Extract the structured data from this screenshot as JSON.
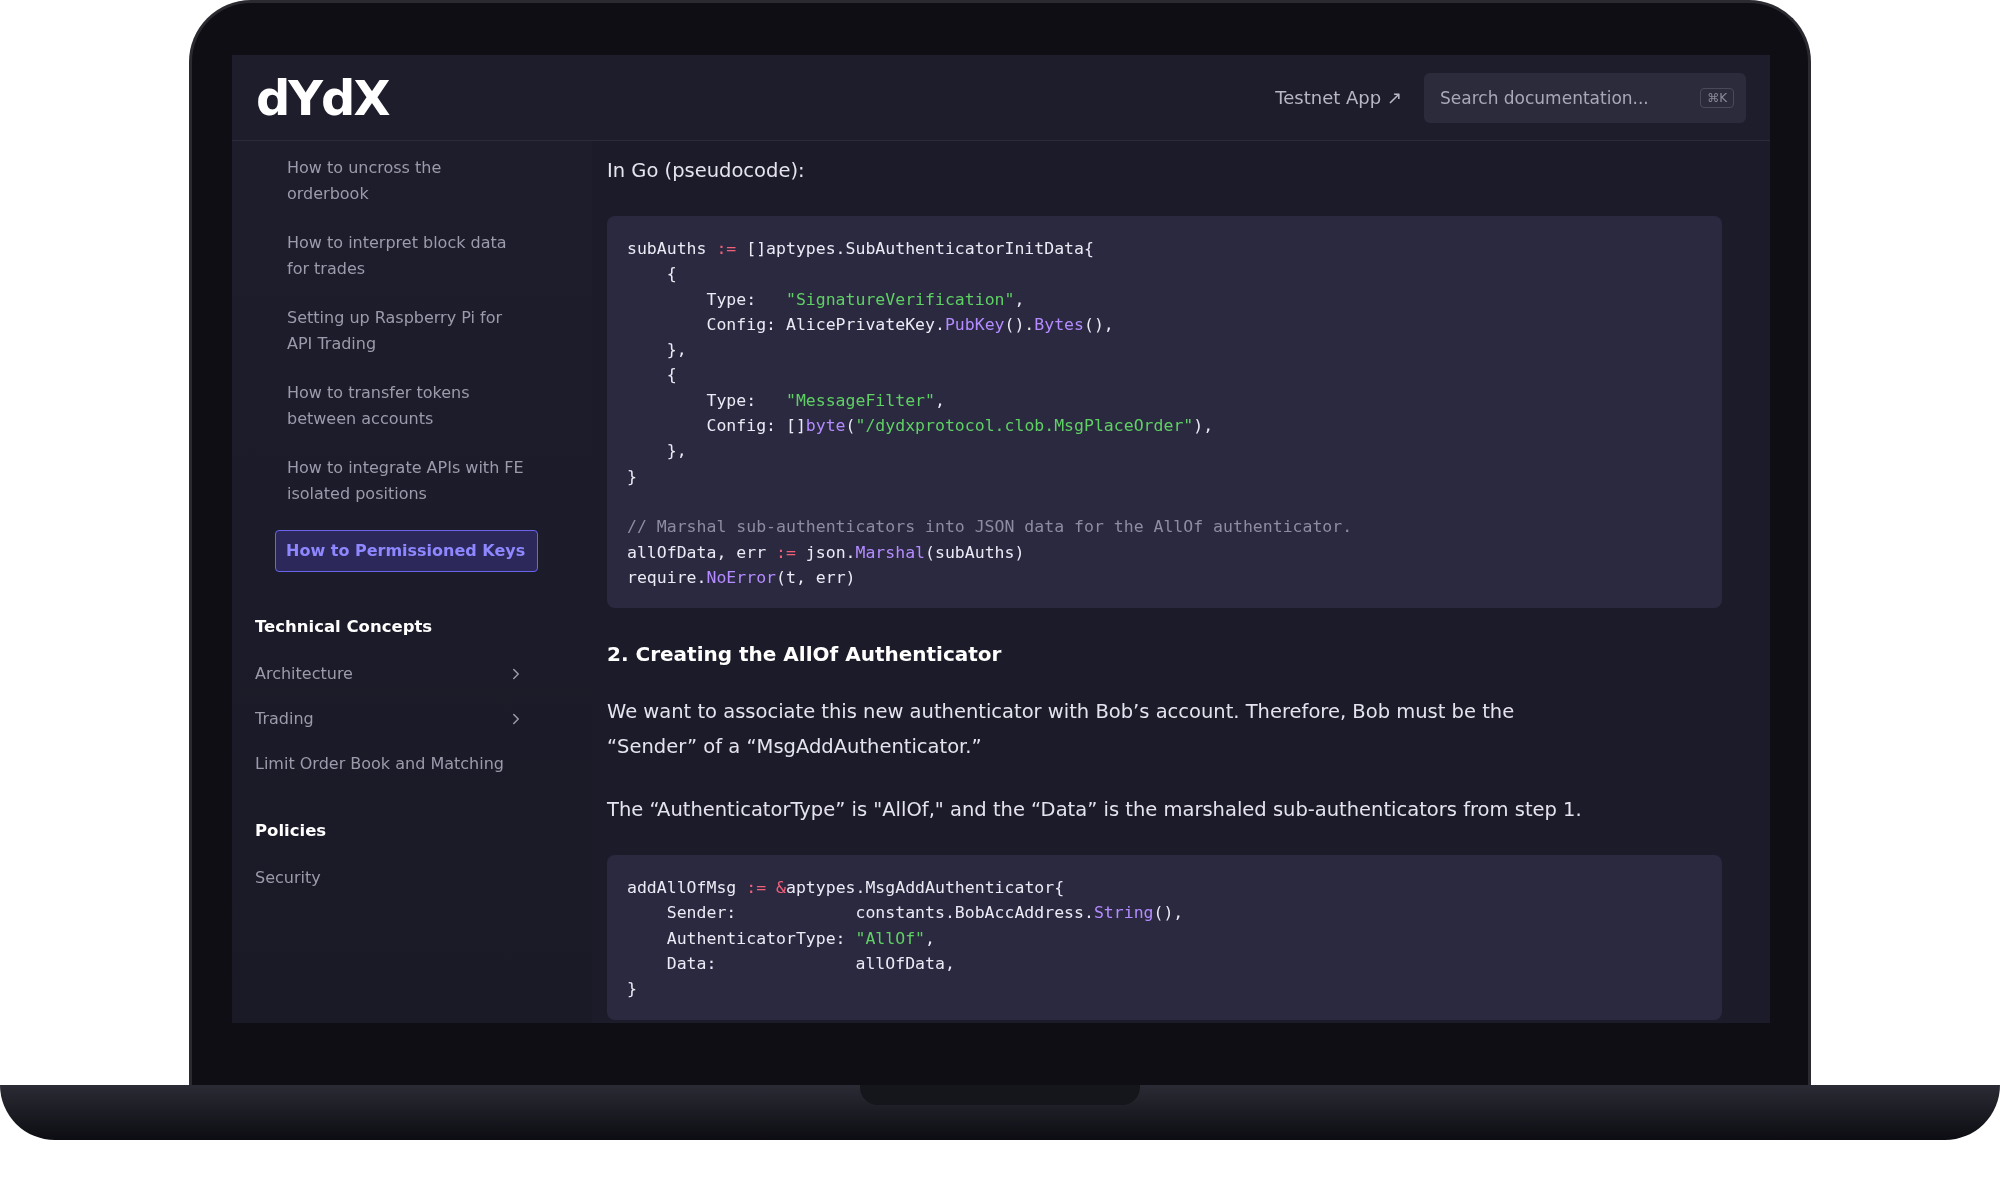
{
  "header": {
    "logo": "dYdX",
    "testnet_link": "Testnet App ↗",
    "search": {
      "placeholder": "Search documentation...",
      "shortcut": "⌘K"
    }
  },
  "sidebar": {
    "guides": [
      {
        "label": "How to uncross the orderbook",
        "selected": false
      },
      {
        "label": "How to interpret block data for trades",
        "selected": false
      },
      {
        "label": "Setting up Raspberry Pi for API Trading",
        "selected": false
      },
      {
        "label": "How to transfer tokens between accounts",
        "selected": false
      },
      {
        "label": "How to integrate APIs with FE isolated positions",
        "selected": false
      },
      {
        "label": "How to Permissioned Keys",
        "selected": true
      }
    ],
    "sections": [
      {
        "title": "Technical Concepts",
        "items": [
          {
            "label": "Architecture",
            "expandable": true
          },
          {
            "label": "Trading",
            "expandable": true
          },
          {
            "label": "Limit Order Book and Matching",
            "expandable": false
          }
        ]
      },
      {
        "title": "Policies",
        "items": [
          {
            "label": "Security",
            "expandable": false
          }
        ]
      }
    ]
  },
  "content": [
    {
      "kind": "paragraph",
      "text": "In Go (pseudocode):"
    },
    {
      "kind": "code",
      "groups": [
        [
          [
            {
              "text": "subAuths ",
              "kind": "plain"
            },
            {
              "text": ":=",
              "kind": "operator"
            },
            {
              "text": " []aptypes.SubAuthenticatorInitData{",
              "kind": "plain"
            }
          ],
          [
            {
              "text": "    {",
              "kind": "plain"
            }
          ],
          [
            {
              "text": "        Type:   ",
              "kind": "plain"
            },
            {
              "text": "\"SignatureVerification\"",
              "kind": "string"
            },
            {
              "text": ",",
              "kind": "plain"
            }
          ],
          [
            {
              "text": "        Config: AlicePrivateKey.",
              "kind": "plain"
            },
            {
              "text": "PubKey",
              "kind": "function"
            },
            {
              "text": "().",
              "kind": "plain"
            },
            {
              "text": "Bytes",
              "kind": "function"
            },
            {
              "text": "(),",
              "kind": "plain"
            }
          ],
          [
            {
              "text": "    },",
              "kind": "plain"
            }
          ],
          [
            {
              "text": "    {",
              "kind": "plain"
            }
          ],
          [
            {
              "text": "        Type:   ",
              "kind": "plain"
            },
            {
              "text": "\"MessageFilter\"",
              "kind": "string"
            },
            {
              "text": ",",
              "kind": "plain"
            }
          ],
          [
            {
              "text": "        Config: []",
              "kind": "plain"
            },
            {
              "text": "byte",
              "kind": "function"
            },
            {
              "text": "(",
              "kind": "plain"
            },
            {
              "text": "\"/dydxprotocol.clob.MsgPlaceOrder\"",
              "kind": "string"
            },
            {
              "text": "),",
              "kind": "plain"
            }
          ],
          [
            {
              "text": "    },",
              "kind": "plain"
            }
          ],
          [
            {
              "text": "}",
              "kind": "plain"
            }
          ]
        ],
        [
          [
            {
              "text": "// Marshal sub-authenticators into JSON data for the AllOf authenticator.",
              "kind": "comment"
            }
          ],
          [
            {
              "text": "allOfData, err ",
              "kind": "plain"
            },
            {
              "text": ":=",
              "kind": "operator"
            },
            {
              "text": " json.",
              "kind": "plain"
            },
            {
              "text": "Marshal",
              "kind": "function"
            },
            {
              "text": "(subAuths)",
              "kind": "plain"
            }
          ],
          [
            {
              "text": "require.",
              "kind": "plain"
            },
            {
              "text": "NoError",
              "kind": "function"
            },
            {
              "text": "(t, err)",
              "kind": "plain"
            }
          ]
        ]
      ]
    },
    {
      "kind": "heading",
      "text": "2. Creating the AllOf Authenticator"
    },
    {
      "kind": "paragraph",
      "text": "We want to associate this new authenticator with Bob’s account. Therefore, Bob must be the “Sender” of a “MsgAddAuthenticator.”"
    },
    {
      "kind": "paragraph",
      "text": "The “AuthenticatorType” is \"AllOf,\" and the “Data” is the marshaled sub-authenticators from step 1."
    },
    {
      "kind": "code",
      "groups": [
        [
          [
            {
              "text": "addAllOfMsg ",
              "kind": "plain"
            },
            {
              "text": ":= &",
              "kind": "operator"
            },
            {
              "text": "aptypes.MsgAddAuthenticator{",
              "kind": "plain"
            }
          ],
          [
            {
              "text": "    Sender:            constants.BobAccAddress.",
              "kind": "plain"
            },
            {
              "text": "String",
              "kind": "function"
            },
            {
              "text": "(),",
              "kind": "plain"
            }
          ],
          [
            {
              "text": "    AuthenticatorType: ",
              "kind": "plain"
            },
            {
              "text": "\"AllOf\"",
              "kind": "string"
            },
            {
              "text": ",",
              "kind": "plain"
            }
          ],
          [
            {
              "text": "    Data:              allOfData,",
              "kind": "plain"
            }
          ],
          [
            {
              "text": "}",
              "kind": "plain"
            }
          ]
        ]
      ]
    }
  ]
}
